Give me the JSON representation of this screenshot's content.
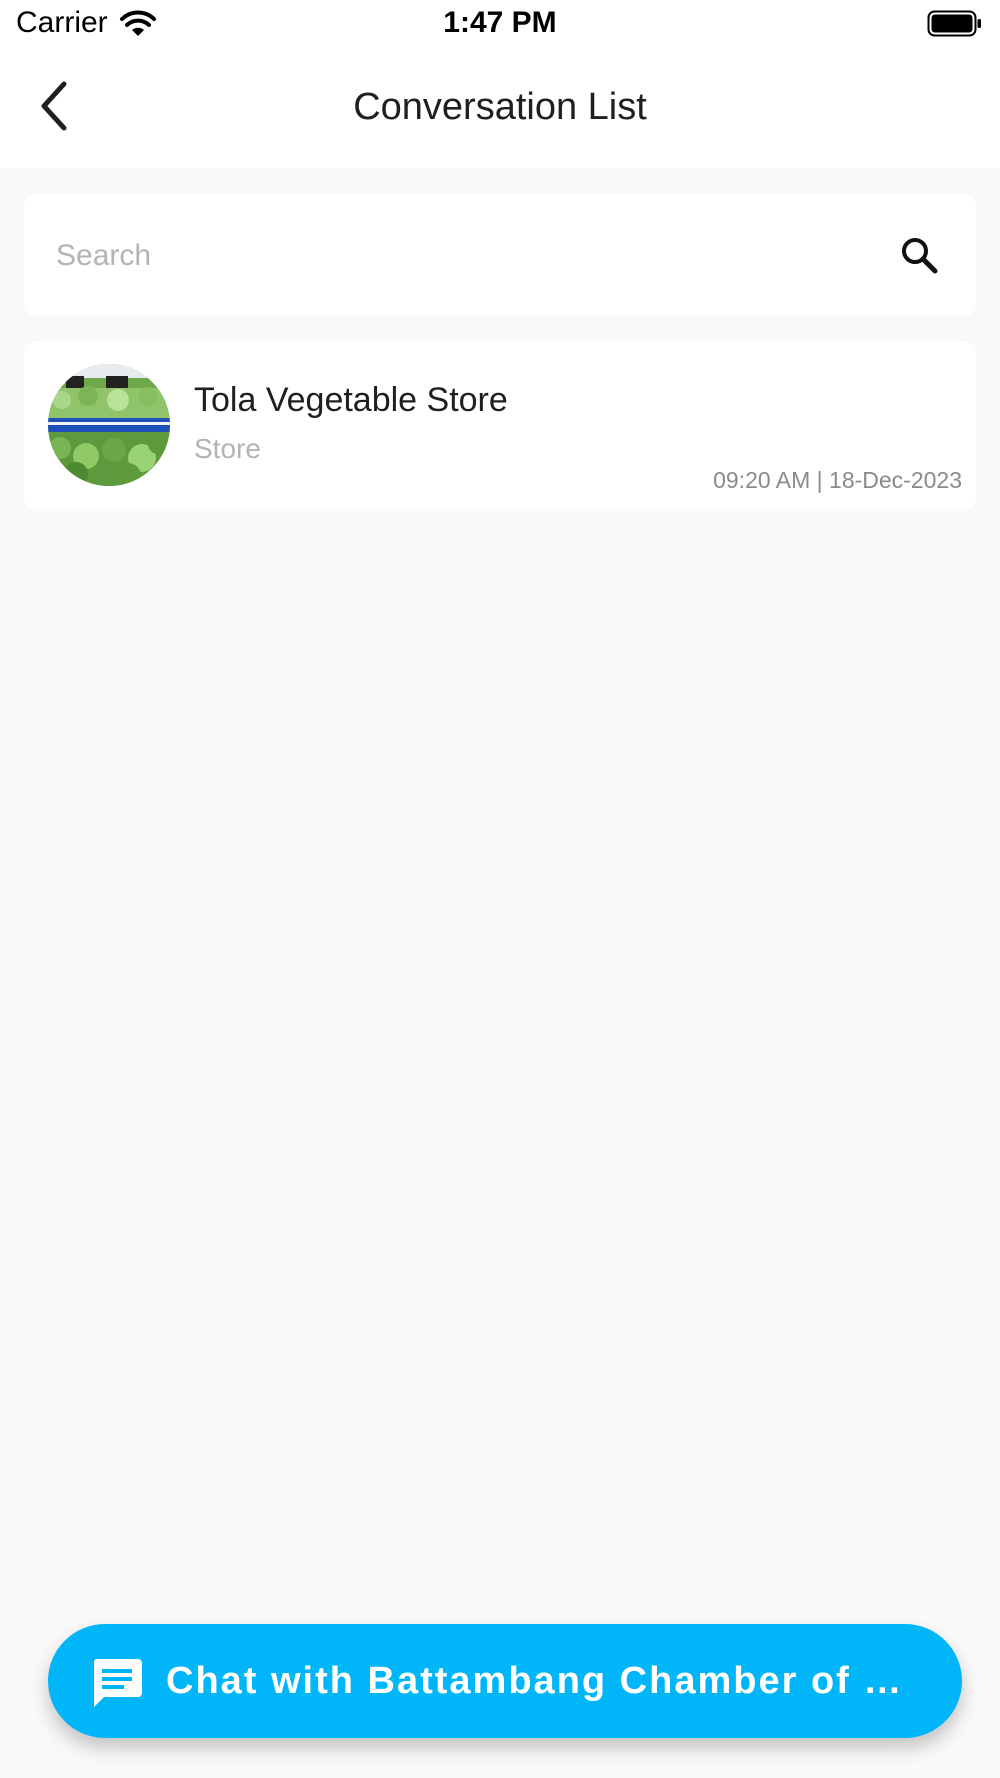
{
  "status_bar": {
    "carrier": "Carrier",
    "time": "1:47 PM",
    "wifi_icon": "wifi-icon",
    "battery_icon": "battery-full-icon"
  },
  "header": {
    "back_icon": "chevron-left-icon",
    "title": "Conversation List"
  },
  "search": {
    "placeholder": "Search",
    "value": "",
    "icon": "search-icon"
  },
  "conversations": [
    {
      "name": "Tola Vegetable Store",
      "type": "Store",
      "timestamp": "09:20 AM | 18-Dec-2023",
      "avatar": "store-photo"
    }
  ],
  "fab": {
    "icon": "chat-bubble-icon",
    "label": "Chat with Battambang Chamber of …"
  },
  "colors": {
    "accent": "#00B6F9",
    "background": "#F9F9F9",
    "card": "#FFFFFF",
    "primary_text": "#1F1F1F",
    "secondary_text": "#B3B3B8"
  }
}
